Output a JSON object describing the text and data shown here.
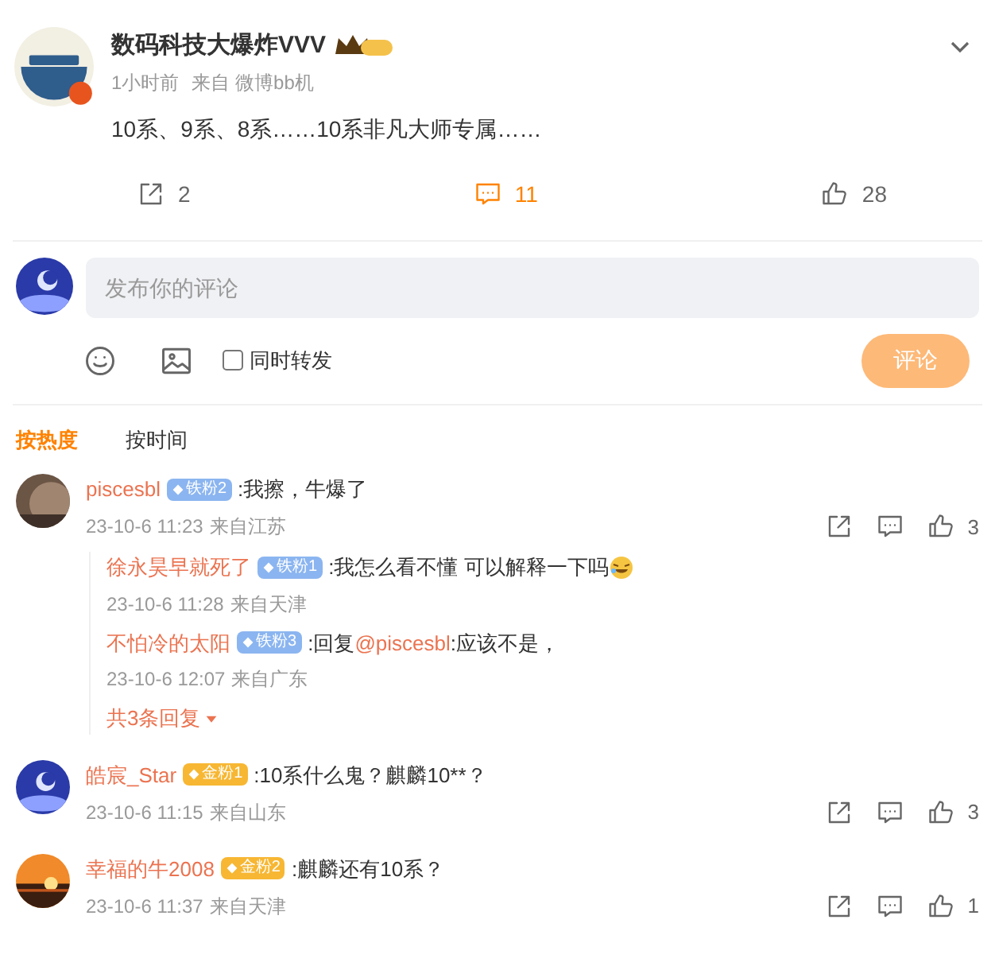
{
  "post": {
    "author": "数码科技大爆炸VVV",
    "time": "1小时前",
    "source": "来自 微博bb机",
    "text": "10系、9系、8系……10系非凡大师专属……",
    "reposts": "2",
    "comments": "11",
    "likes": "28"
  },
  "composer": {
    "placeholder": "发布你的评论",
    "repost_label": "同时转发",
    "repost_checked": false,
    "submit": "评论"
  },
  "sort_tabs": [
    {
      "label": "按热度",
      "selected": true
    },
    {
      "label": "按时间",
      "selected": false
    }
  ],
  "comments": [
    {
      "user": "piscesbl",
      "badge": {
        "label": "铁粉2",
        "kind": "iron"
      },
      "segments": [
        {
          "text": ":我擦，牛爆了"
        }
      ],
      "time": "23-10-6 11:23",
      "location": "来自江苏",
      "likes": "3",
      "replies": [
        {
          "user": "徐永昊早就死了",
          "badge": {
            "label": "铁粉1",
            "kind": "iron"
          },
          "segments": [
            {
              "text": ":我怎么看不懂 可以解释一下吗"
            }
          ],
          "trailing_emoji": true,
          "time": "23-10-6 11:28",
          "location": "来自天津"
        },
        {
          "user": "不怕冷的太阳",
          "badge": {
            "label": "铁粉3",
            "kind": "iron"
          },
          "segments": [
            {
              "text": ":回复"
            },
            {
              "text": "@piscesbl",
              "kind": "mention"
            },
            {
              "text": ":应该不是，"
            }
          ],
          "trailing_emoji": false,
          "time": "23-10-6 12:07",
          "location": "来自广东"
        }
      ],
      "more_replies": "共3条回复"
    },
    {
      "user": "皓宸_Star",
      "badge": {
        "label": "金粉1",
        "kind": "gold"
      },
      "segments": [
        {
          "text": ":10系什么鬼？麒麟10**？"
        }
      ],
      "time": "23-10-6 11:15",
      "location": "来自山东",
      "likes": "3"
    },
    {
      "user": "幸福的牛2008",
      "badge": {
        "label": "金粉2",
        "kind": "gold"
      },
      "segments": [
        {
          "text": ":麒麟还有10系？"
        }
      ],
      "time": "23-10-6 11:37",
      "location": "来自天津",
      "likes": "1"
    }
  ]
}
